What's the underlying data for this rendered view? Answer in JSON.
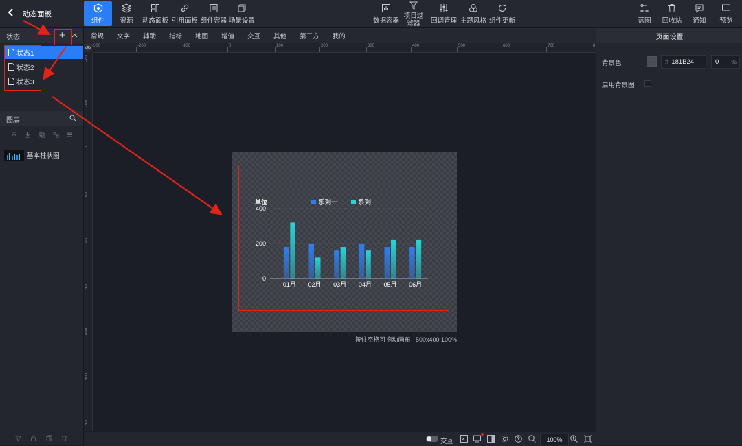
{
  "topbar": {
    "back_title": "动态面板",
    "left_buttons": [
      {
        "label": "组件",
        "icon": "component-icon",
        "active": true
      },
      {
        "label": "资源",
        "icon": "layers-icon"
      },
      {
        "label": "动态面板",
        "icon": "dashboard-icon"
      },
      {
        "label": "引用面板",
        "icon": "link-icon"
      },
      {
        "label": "组件容器",
        "icon": "container-icon"
      },
      {
        "label": "场景设置",
        "icon": "scene-icon"
      }
    ],
    "center_buttons": [
      {
        "label": "数据容器",
        "icon": "data-container-icon"
      },
      {
        "label": "项目过滤器",
        "icon": "filter-icon"
      },
      {
        "label": "回调管理",
        "icon": "sliders-icon"
      },
      {
        "label": "主题风格",
        "icon": "theme-icon"
      },
      {
        "label": "组件更新",
        "icon": "refresh-icon"
      }
    ],
    "right_buttons": [
      {
        "label": "蓝图",
        "icon": "blueprint-icon"
      },
      {
        "label": "回收站",
        "icon": "trash-icon"
      },
      {
        "label": "通知",
        "icon": "notification-icon"
      },
      {
        "label": "预览",
        "icon": "preview-icon"
      }
    ]
  },
  "states": {
    "title": "状态",
    "add_label": "+",
    "items": [
      "状态1",
      "状态2",
      "状态3"
    ]
  },
  "layers": {
    "title": "图层",
    "items": [
      {
        "label": "基本柱状图"
      }
    ]
  },
  "tabs": [
    "常规",
    "文字",
    "辅助",
    "指标",
    "地图",
    "增值",
    "交互",
    "其他",
    "第三方",
    "我的"
  ],
  "ruler": {
    "top": [
      "-300",
      "-200",
      "-100",
      "0",
      "100",
      "200",
      "300",
      "400",
      "500",
      "600",
      "700",
      "8"
    ],
    "left": [
      "-200",
      "-100",
      "0",
      "100",
      "200",
      "300",
      "400",
      "500",
      "600"
    ]
  },
  "canvas_info": "按住空格可拖动画布   500x400 100%",
  "chart_data": {
    "type": "bar",
    "ylabel": "单位",
    "categories": [
      "01月",
      "02月",
      "03月",
      "04月",
      "05月",
      "06月"
    ],
    "series": [
      {
        "name": "系列一",
        "values": [
          180,
          200,
          160,
          200,
          180,
          180
        ],
        "color": "#2f7ff0"
      },
      {
        "name": "系列二",
        "values": [
          320,
          120,
          180,
          160,
          220,
          220
        ],
        "color": "#27d4d8"
      }
    ],
    "ylim": [
      0,
      400
    ],
    "yticks": [
      "0",
      "200",
      "400"
    ],
    "legend": "top-center",
    "grid": true
  },
  "right_panel": {
    "title": "页面设置",
    "bg_color_label": "背景色",
    "bg_color_value": "181B24",
    "hash": "#",
    "opacity_value": "0",
    "opacity_unit": "%",
    "enable_bg_image_label": "启用背景图"
  },
  "bottom": {
    "interaction_label": "交互",
    "zoom_value": "100%"
  },
  "colors": {
    "accent": "#2b7df5",
    "annotation_red": "#e2231a"
  }
}
